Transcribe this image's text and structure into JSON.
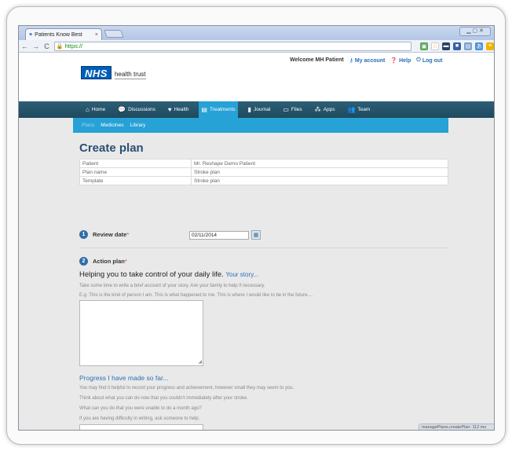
{
  "browser": {
    "tab_title": "Patients Know Best",
    "tab_close": "×",
    "url": "https://",
    "status_text": "managePlans.createPlan: 112 ms"
  },
  "header": {
    "welcome": "Welcome MH Patient",
    "my_account": "My account",
    "help": "Help",
    "log_out": "Log out",
    "logo_text": "NHS",
    "logo_subtitle": "health trust"
  },
  "mainnav": {
    "items": [
      {
        "label": "Home",
        "icon": "home-icon"
      },
      {
        "label": "Discussions",
        "icon": "chat-icon"
      },
      {
        "label": "Health",
        "icon": "heart-icon"
      },
      {
        "label": "Treatments",
        "icon": "clipboard-icon"
      },
      {
        "label": "Journal",
        "icon": "journal-icon"
      },
      {
        "label": "Files",
        "icon": "folder-icon"
      },
      {
        "label": "Apps",
        "icon": "apps-icon"
      },
      {
        "label": "Team",
        "icon": "team-icon"
      }
    ]
  },
  "subnav": {
    "items": [
      {
        "label": "Plans"
      },
      {
        "label": "Medicines"
      },
      {
        "label": "Library"
      }
    ]
  },
  "main": {
    "title": "Create plan",
    "info_rows": [
      {
        "label": "Patient",
        "value": "Mr. Reshape Demo Patient"
      },
      {
        "label": "Plan name",
        "value": "Stroke plan"
      },
      {
        "label": "Template",
        "value": "Stroke plan"
      }
    ],
    "step1": {
      "num": "1",
      "label": "Review date",
      "req": "*",
      "date_value": "02/11/2014"
    },
    "step2": {
      "num": "2",
      "label": "Action plan",
      "req": "*"
    },
    "help_heading": "Helping you to take control of your daily life.",
    "your_story_link": "Your story...",
    "story_p1": "Take some time to write a brief account of your story. Ask your family to help if necessary.",
    "story_p2": "E.g. This is the kind of person I am. This is what happened to me. This is where I would like to be in the future....",
    "progress_heading": "Progress I have made so far...",
    "progress_p1": "You may find it helpful to record your progress and achievement, however small they may seem to you.",
    "progress_p2": "Think about what you can do now that you couldn't immediately after your stroke.",
    "progress_p3": "What can you do that you were unable to do a month ago?",
    "progress_p4": "If you are having difficulty in writing, ask someone to help."
  }
}
